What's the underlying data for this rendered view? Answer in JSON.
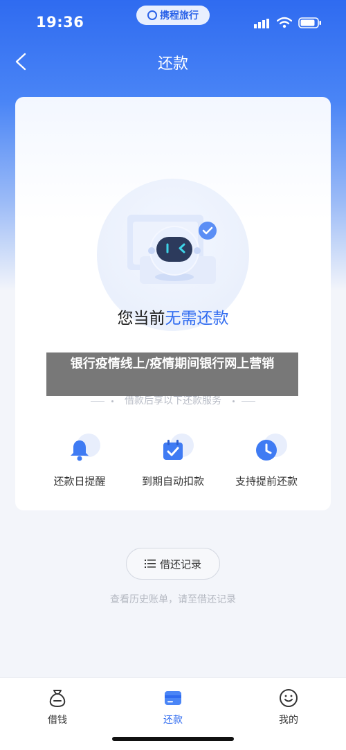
{
  "status_bar": {
    "time": "19:36",
    "brand": "携程旅行"
  },
  "nav": {
    "title": "还款",
    "back_icon": "chevron-left-icon"
  },
  "card": {
    "heading_prefix": "您当前",
    "heading_highlight": "无需还款",
    "services_caption": "借款后享以下还款服务",
    "features": [
      {
        "label": "还款日提醒",
        "icon": "bell-icon"
      },
      {
        "label": "到期自动扣款",
        "icon": "calendar-check-icon"
      },
      {
        "label": "支持提前还款",
        "icon": "clock-icon"
      }
    ]
  },
  "overlay_banner": {
    "text": "银行疫情线上/疫情期间银行网上营销"
  },
  "records": {
    "button_label": "借还记录",
    "hint": "查看历史账单，请至借还记录"
  },
  "tab_bar": {
    "items": [
      {
        "label": "借钱",
        "icon": "money-bag-icon",
        "active": false
      },
      {
        "label": "还款",
        "icon": "card-icon",
        "active": true
      },
      {
        "label": "我的",
        "icon": "smiley-icon",
        "active": false
      }
    ]
  },
  "colors": {
    "accent": "#2f6bf0",
    "header_gradient_top": "#2f6bf0"
  }
}
